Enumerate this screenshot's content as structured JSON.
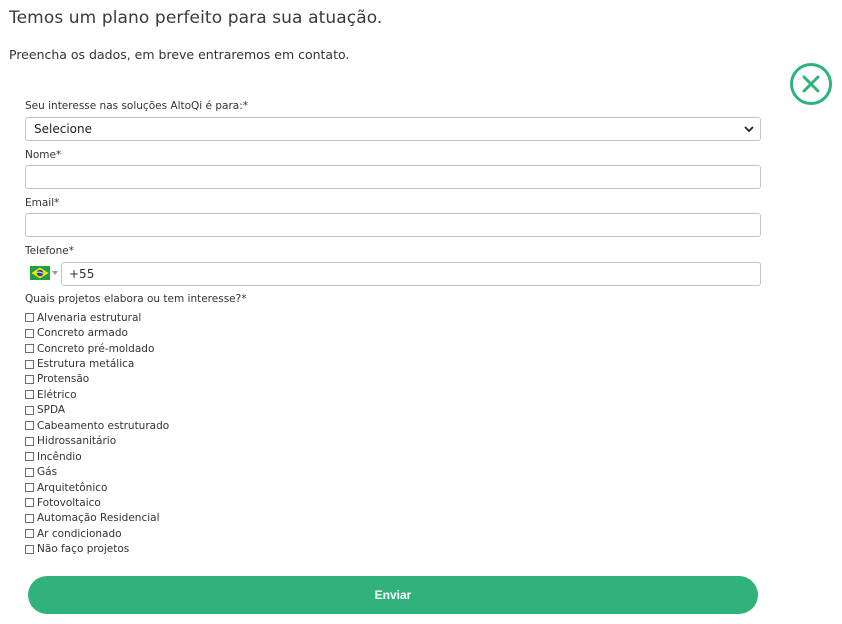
{
  "header": {
    "title": "Temos um plano perfeito para sua atuação.",
    "subtitle": "Preencha os dados, em breve entraremos em contato."
  },
  "close_icon": "close-circle-icon",
  "colors": {
    "accent": "#2fb37a",
    "border": "#c4c4c4",
    "text": "#333333"
  },
  "form": {
    "interest_label": "Seu interesse nas soluções AltoQi é para:*",
    "interest_value": "Selecione",
    "name_label": "Nome*",
    "name_value": "",
    "email_label": "Email*",
    "email_value": "",
    "phone_label": "Telefone*",
    "phone_country_icon": "brazil-flag-icon",
    "phone_value": "+55",
    "projects_label": "Quais projetos elabora ou tem interesse?*",
    "projects": [
      "Alvenaria estrutural",
      "Concreto armado",
      "Concreto pré-moldado",
      "Estrutura metálica",
      "Protensão",
      "Elétrico",
      "SPDA",
      "Cabeamento estruturado",
      "Hidrossanitário",
      "Incêndio",
      "Gás",
      "Arquitetônico",
      "Fotovoltaico",
      "Automação Residencial",
      "Ar condicionado",
      "Não faço projetos"
    ],
    "submit_label": "Enviar"
  }
}
